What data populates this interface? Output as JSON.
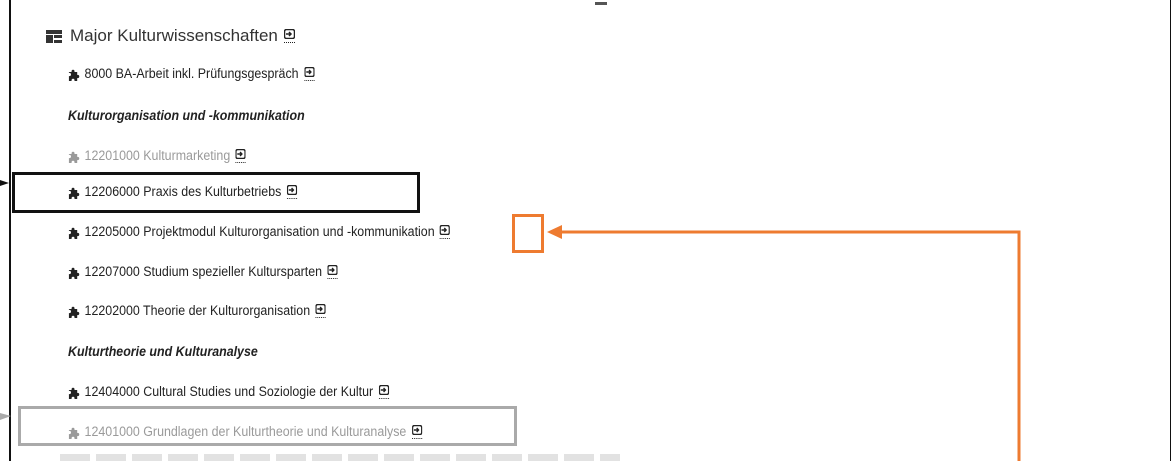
{
  "header": {
    "title": "Major Kulturwissenschaften"
  },
  "items": {
    "ba": "8000 BA-Arbeit inkl. Prüfungsgespräch",
    "cat1": "Kulturorganisation und -kommunikation",
    "km": "12201000 Kulturmarketing",
    "praxis": "12206000 Praxis des Kulturbetriebs",
    "projekt": "12205000 Projektmodul Kulturorganisation und -kommunikation",
    "studium": "12207000 Studium spezieller Kultursparten",
    "theorie": "12202000 Theorie der Kulturorganisation",
    "cat2": "Kulturtheorie und Kulturanalyse",
    "cultural": "12404000 Cultural Studies und Soziologie der Kultur",
    "grundlagen": "12401000 Grundlagen der Kulturtheorie und Kulturanalyse"
  },
  "colors": {
    "highlight_orange": "#ee7b30",
    "highlight_black": "#111111",
    "highlight_grey": "#aaaaaa",
    "disabled_text": "#9a9a9a"
  },
  "icons": {
    "header": "tree-grid-icon",
    "module": "puzzle-icon",
    "link": "open-external-icon"
  }
}
